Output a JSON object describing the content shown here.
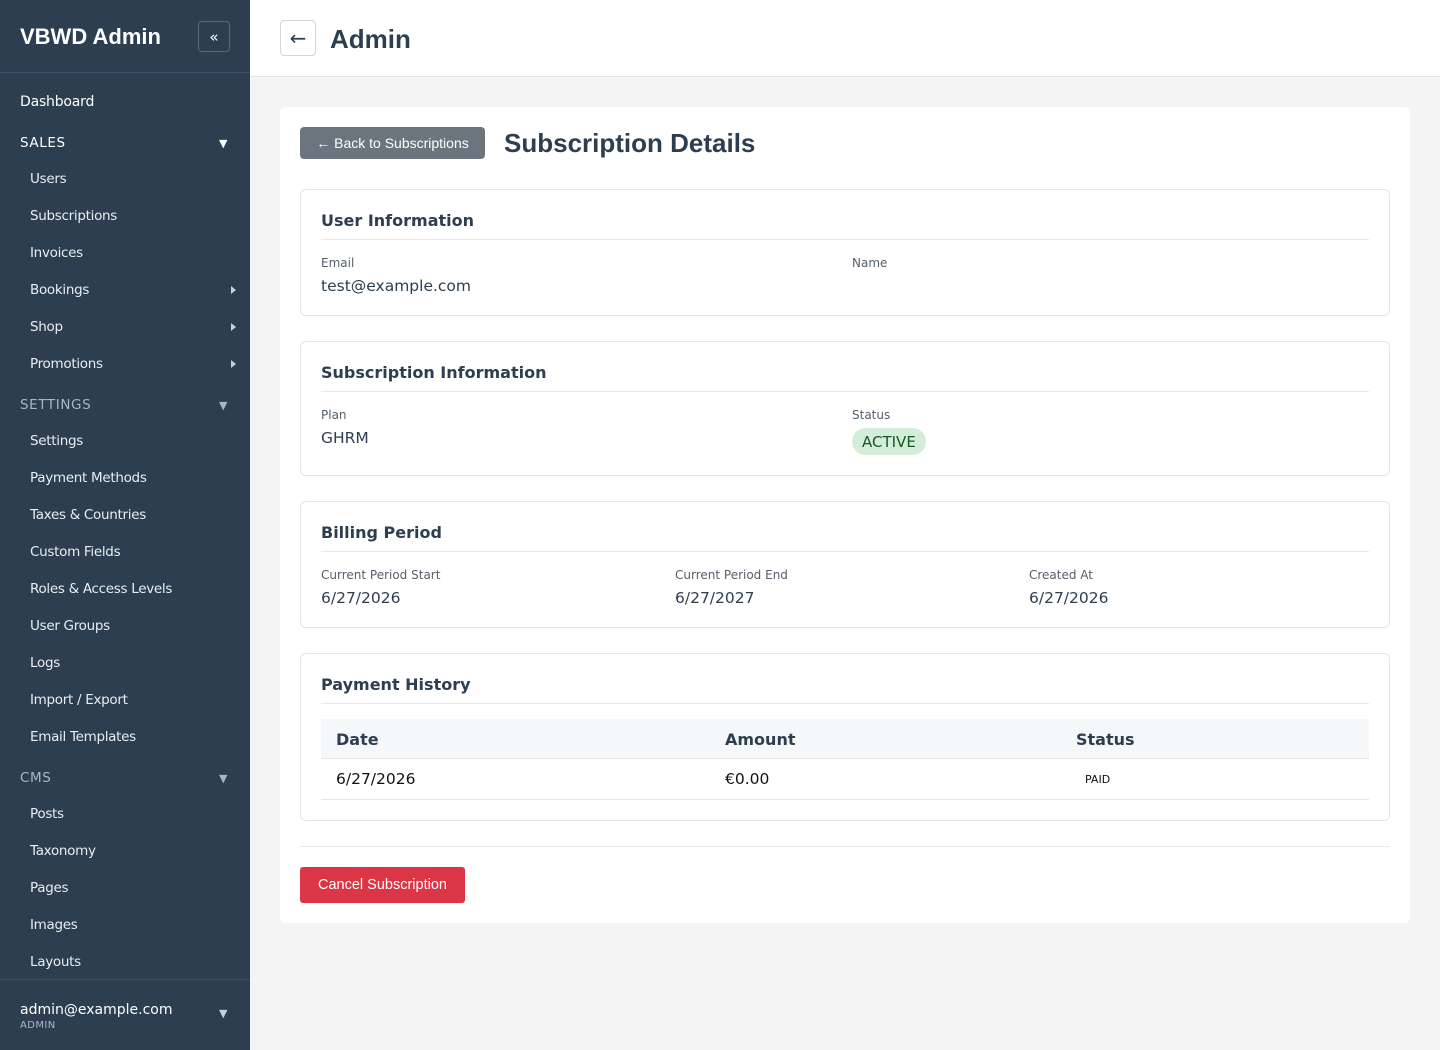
{
  "sidebar": {
    "brand": "VBWD Admin",
    "collapse_icon": "«",
    "dashboard": "Dashboard",
    "sections": [
      {
        "title": "SALES",
        "items": [
          {
            "label": "Users",
            "has_submenu": false
          },
          {
            "label": "Subscriptions",
            "has_submenu": false
          },
          {
            "label": "Invoices",
            "has_submenu": false
          },
          {
            "label": "Bookings",
            "has_submenu": true
          },
          {
            "label": "Shop",
            "has_submenu": true
          },
          {
            "label": "Promotions",
            "has_submenu": true
          }
        ]
      },
      {
        "title": "SETTINGS",
        "items": [
          {
            "label": "Settings"
          },
          {
            "label": "Payment Methods"
          },
          {
            "label": "Taxes & Countries"
          },
          {
            "label": "Custom Fields"
          },
          {
            "label": "Roles & Access Levels"
          },
          {
            "label": "User Groups"
          },
          {
            "label": "Logs"
          },
          {
            "label": "Import / Export"
          },
          {
            "label": "Email Templates"
          }
        ]
      },
      {
        "title": "CMS",
        "items": [
          {
            "label": "Posts"
          },
          {
            "label": "Taxonomy"
          },
          {
            "label": "Pages"
          },
          {
            "label": "Images"
          },
          {
            "label": "Layouts"
          }
        ]
      }
    ],
    "caret": "▼",
    "footer": {
      "email": "admin@example.com",
      "role": "ADMIN"
    },
    "colors": {
      "background": "#2c3e50",
      "inactive_section": "#aab6c2"
    }
  },
  "topbar": {
    "back_icon": "←",
    "title": "Admin"
  },
  "content": {
    "back_button": "← Back to Subscriptions",
    "title": "Subscription Details",
    "user_info": {
      "heading": "User Information",
      "email_label": "Email",
      "email_value": "test@example.com",
      "name_label": "Name",
      "name_value": ""
    },
    "subscription_info": {
      "heading": "Subscription Information",
      "plan_label": "Plan",
      "plan_value": "GHRM",
      "status_label": "Status",
      "status_value": "ACTIVE"
    },
    "billing": {
      "heading": "Billing Period",
      "start_label": "Current Period Start",
      "start_value": "6/27/2026",
      "end_label": "Current Period End",
      "end_value": "6/27/2027",
      "created_label": "Created At",
      "created_value": "6/27/2026"
    },
    "payments": {
      "heading": "Payment History",
      "columns": [
        "Date",
        "Amount",
        "Status"
      ],
      "rows": [
        {
          "date": "6/27/2026",
          "amount": "€0.00",
          "status": "PAID"
        }
      ]
    },
    "cancel_button": "Cancel Subscription",
    "colors": {
      "danger": "#dc3545",
      "secondary": "#6c757d",
      "success_bg": "#d4edda",
      "success_text": "#155724"
    }
  }
}
